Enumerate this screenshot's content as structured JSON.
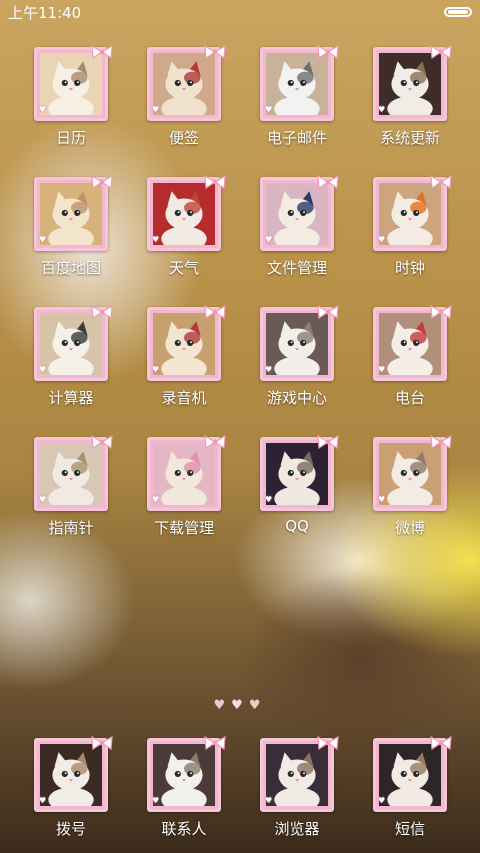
{
  "status_bar": {
    "time": "上午11:40"
  },
  "apps": [
    {
      "label": "日历",
      "bg": "#e9d4b3",
      "fur": "#f6efe4",
      "spot": "#a98a6e"
    },
    {
      "label": "便签",
      "bg": "#cfa98a",
      "fur": "#efe2cf",
      "spot": "#b23a3a"
    },
    {
      "label": "电子邮件",
      "bg": "#c9b29a",
      "fur": "#f2f2f2",
      "spot": "#6f6f6f"
    },
    {
      "label": "系统更新",
      "bg": "#3e2c2a",
      "fur": "#f1ece6",
      "spot": "#8b6f57"
    },
    {
      "label": "百度地图",
      "bg": "#d7b27a",
      "fur": "#f3e4cc",
      "spot": "#b9926a"
    },
    {
      "label": "天气",
      "bg": "#b52b2e",
      "fur": "#f1ebe3",
      "spot": "#c2453b"
    },
    {
      "label": "文件管理",
      "bg": "#d8b6c2",
      "fur": "#f3ece3",
      "spot": "#2a3b6a"
    },
    {
      "label": "时钟",
      "bg": "#caa57e",
      "fur": "#f4ece2",
      "spot": "#e3701f"
    },
    {
      "label": "计算器",
      "bg": "#d7c3a8",
      "fur": "#f5f0e8",
      "spot": "#3b3b3b"
    },
    {
      "label": "录音机",
      "bg": "#c7a070",
      "fur": "#f2e6d2",
      "spot": "#b23a3a"
    },
    {
      "label": "游戏中心",
      "bg": "#6a5a55",
      "fur": "#f2efea",
      "spot": "#8a8078"
    },
    {
      "label": "电台",
      "bg": "#b0907a",
      "fur": "#f4eee6",
      "spot": "#c23a3a"
    },
    {
      "label": "指南针",
      "bg": "#d9c7b6",
      "fur": "#f1eae2",
      "spot": "#a9936f"
    },
    {
      "label": "下载管理",
      "bg": "#e3b7c4",
      "fur": "#f1e7da",
      "spot": "#e38fac"
    },
    {
      "label": "QQ",
      "bg": "#2c2233",
      "fur": "#efe9e2",
      "spot": "#7d6b5a"
    },
    {
      "label": "微博",
      "bg": "#c9a073",
      "fur": "#f3ece3",
      "spot": "#8d7a6a"
    }
  ],
  "dock": [
    {
      "label": "拨号",
      "bg": "#3b2a23",
      "fur": "#f1ece6",
      "spot": "#a98a6e"
    },
    {
      "label": "联系人",
      "bg": "#4a3a38",
      "fur": "#f2f0ec",
      "spot": "#8b7a6a"
    },
    {
      "label": "浏览器",
      "bg": "#3a2d3a",
      "fur": "#f0ebe4",
      "spot": "#8a7060"
    },
    {
      "label": "短信",
      "bg": "#2e2528",
      "fur": "#f1ebe3",
      "spot": "#9a7a5e"
    }
  ],
  "page_indicator": {
    "count": 3,
    "active_index": 1
  },
  "colors": {
    "frame": "#f6c6d8",
    "bow": "#f29ab8",
    "heart": "#f4c3cb"
  }
}
